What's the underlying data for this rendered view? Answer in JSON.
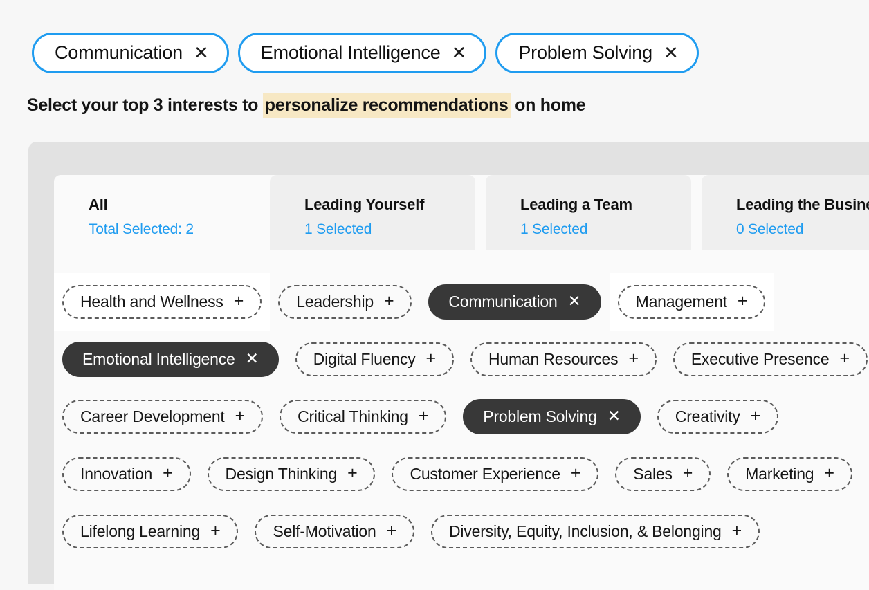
{
  "selected_bar": {
    "pills": [
      {
        "label": "Communication",
        "remove_icon": "close-icon",
        "remove_glyph": "✕"
      },
      {
        "label": "Emotional Intelligence",
        "remove_icon": "close-icon",
        "remove_glyph": "✕"
      },
      {
        "label": "Problem Solving",
        "remove_icon": "close-icon",
        "remove_glyph": "✕"
      }
    ],
    "accent_color": "#1f9cf0"
  },
  "heading": {
    "prefix": "Select your top 3 interests to ",
    "highlight": "personalize recommendations",
    "suffix": " on home",
    "highlight_color": "#f7e8c4"
  },
  "tabs": [
    {
      "title": "All",
      "subtitle": "Total Selected: 2",
      "active": true
    },
    {
      "title": "Leading Yourself",
      "subtitle": "1 Selected",
      "active": false
    },
    {
      "title": "Leading a Team",
      "subtitle": "1 Selected",
      "active": false
    },
    {
      "title": "Leading the Business",
      "subtitle": "0 Selected",
      "active": false
    }
  ],
  "chip_rows": [
    [
      {
        "label": "Health and Wellness",
        "selected": false,
        "glyph": "+",
        "icon": "plus-icon",
        "highlighted": true
      },
      {
        "label": "Leadership",
        "selected": false,
        "glyph": "+",
        "icon": "plus-icon",
        "highlighted": false
      },
      {
        "label": "Communication",
        "selected": true,
        "glyph": "✕",
        "icon": "close-icon",
        "highlighted": false
      },
      {
        "label": "Management",
        "selected": false,
        "glyph": "+",
        "icon": "plus-icon",
        "highlighted": true
      }
    ],
    [
      {
        "label": "Emotional Intelligence",
        "selected": true,
        "glyph": "✕",
        "icon": "close-icon",
        "highlighted": false
      },
      {
        "label": "Digital Fluency",
        "selected": false,
        "glyph": "+",
        "icon": "plus-icon",
        "highlighted": false
      },
      {
        "label": "Human Resources",
        "selected": false,
        "glyph": "+",
        "icon": "plus-icon",
        "highlighted": false
      },
      {
        "label": "Executive Presence",
        "selected": false,
        "glyph": "+",
        "icon": "plus-icon",
        "highlighted": false
      }
    ],
    [
      {
        "label": "Career Development",
        "selected": false,
        "glyph": "+",
        "icon": "plus-icon",
        "highlighted": false
      },
      {
        "label": "Critical Thinking",
        "selected": false,
        "glyph": "+",
        "icon": "plus-icon",
        "highlighted": false
      },
      {
        "label": "Problem Solving",
        "selected": true,
        "glyph": "✕",
        "icon": "close-icon",
        "highlighted": false
      },
      {
        "label": "Creativity",
        "selected": false,
        "glyph": "+",
        "icon": "plus-icon",
        "highlighted": false
      }
    ],
    [
      {
        "label": "Innovation",
        "selected": false,
        "glyph": "+",
        "icon": "plus-icon",
        "highlighted": false
      },
      {
        "label": "Design Thinking",
        "selected": false,
        "glyph": "+",
        "icon": "plus-icon",
        "highlighted": false
      },
      {
        "label": "Customer Experience",
        "selected": false,
        "glyph": "+",
        "icon": "plus-icon",
        "highlighted": false
      },
      {
        "label": "Sales",
        "selected": false,
        "glyph": "+",
        "icon": "plus-icon",
        "highlighted": false
      },
      {
        "label": "Marketing",
        "selected": false,
        "glyph": "+",
        "icon": "plus-icon",
        "highlighted": false
      }
    ],
    [
      {
        "label": "Lifelong Learning",
        "selected": false,
        "glyph": "+",
        "icon": "plus-icon",
        "highlighted": false
      },
      {
        "label": "Self-Motivation",
        "selected": false,
        "glyph": "+",
        "icon": "plus-icon",
        "highlighted": false
      },
      {
        "label": "Diversity, Equity, Inclusion, & Belonging",
        "selected": false,
        "glyph": "+",
        "icon": "plus-icon",
        "highlighted": false
      }
    ]
  ]
}
